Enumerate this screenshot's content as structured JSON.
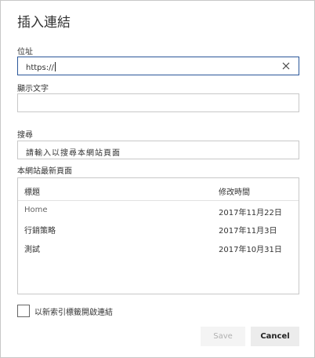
{
  "dialog": {
    "title": "插入連結"
  },
  "address": {
    "label": "位址",
    "value": "https://"
  },
  "display_text": {
    "label": "顯示文字",
    "value": ""
  },
  "search": {
    "label": "搜尋",
    "placeholder": "請輸入以搜尋本網站頁面"
  },
  "recent_pages": {
    "label": "本網站最新頁面",
    "columns": [
      "標題",
      "修改時間"
    ],
    "rows": [
      {
        "title": "Home",
        "modified": "2017年11月22日"
      },
      {
        "title": "行銷策略",
        "modified": "2017年11月3日"
      },
      {
        "title": "測試",
        "modified": "2017年10月31日"
      }
    ]
  },
  "new_tab": {
    "label": "以新索引標籤開啟連結",
    "checked": false
  },
  "buttons": {
    "save": "Save",
    "cancel": "Cancel"
  },
  "icons": {
    "clear": "close-icon"
  },
  "colors": {
    "focus_border": "#2b579a",
    "border": "#c8c8c8",
    "disabled_text": "#b0b0b0"
  }
}
